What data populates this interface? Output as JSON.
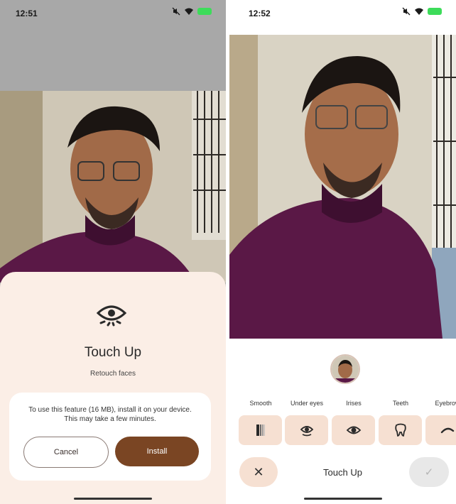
{
  "left": {
    "status": {
      "time": "12:51"
    },
    "sheet": {
      "icon": "eye-icon",
      "title": "Touch Up",
      "subtitle": "Retouch faces",
      "message_line1": "To use this feature (16 MB), install it on your device.",
      "message_line2": "This may take a few minutes.",
      "cancel_label": "Cancel",
      "install_label": "Install"
    }
  },
  "right": {
    "status": {
      "time": "12:52"
    },
    "tools": [
      {
        "label": "Smooth",
        "icon": "smooth-icon"
      },
      {
        "label": "Under eyes",
        "icon": "under-eyes-icon"
      },
      {
        "label": "Irises",
        "icon": "irises-icon"
      },
      {
        "label": "Teeth",
        "icon": "teeth-icon"
      },
      {
        "label": "Eyebrow",
        "icon": "eyebrow-icon"
      }
    ],
    "bar": {
      "title": "Touch Up",
      "close_icon": "close-icon",
      "done_icon": "checkmark-icon"
    }
  },
  "colors": {
    "sheet_bg": "#fbeee6",
    "install_button": "#7a4523",
    "tool_button_bg": "#f6e0d2",
    "shirt": "#5a1846"
  }
}
